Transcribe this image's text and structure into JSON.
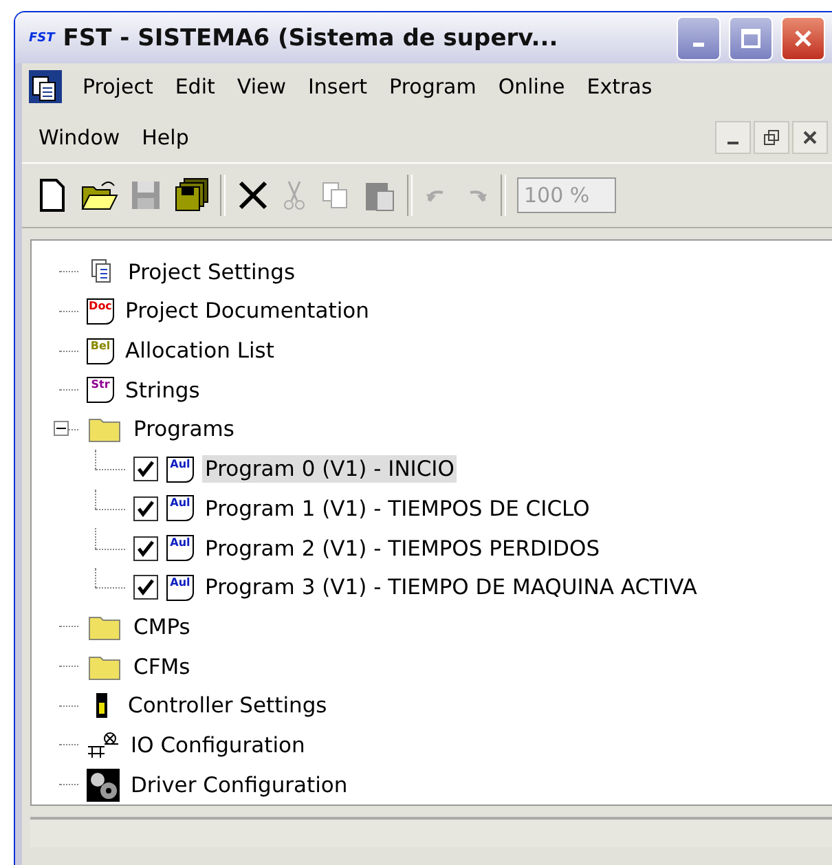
{
  "window": {
    "logo": "FST",
    "title": "FST - SISTEMA6 (Sistema de superv..."
  },
  "menu": [
    {
      "label": "Project"
    },
    {
      "label": "Edit"
    },
    {
      "label": "View"
    },
    {
      "label": "Insert"
    },
    {
      "label": "Program"
    },
    {
      "label": "Online"
    },
    {
      "label": "Extras"
    },
    {
      "label": "Window"
    },
    {
      "label": "Help"
    }
  ],
  "toolbar": {
    "zoom": "100 %"
  },
  "tree": [
    {
      "kind": "settings",
      "label": "Project Settings"
    },
    {
      "kind": "doc",
      "badge": "Doc",
      "label": "Project Documentation"
    },
    {
      "kind": "alloc",
      "badge": "Bel",
      "label": "Allocation List"
    },
    {
      "kind": "strings",
      "badge": "Str",
      "label": "Strings"
    },
    {
      "kind": "folder",
      "label": "Programs",
      "expanded": true,
      "children": [
        {
          "kind": "program",
          "badge": "Aul",
          "label": "Program  0 (V1) - INICIO",
          "checked": true,
          "selected": true
        },
        {
          "kind": "program",
          "badge": "Aul",
          "label": "Program  1 (V1) - TIEMPOS DE CICLO",
          "checked": true,
          "selected": false
        },
        {
          "kind": "program",
          "badge": "Aul",
          "label": "Program  2 (V1) - TIEMPOS PERDIDOS",
          "checked": true,
          "selected": false
        },
        {
          "kind": "program",
          "badge": "Aul",
          "label": "Program  3 (V1) - TIEMPO DE MAQUINA ACTIVA",
          "checked": true,
          "selected": false
        }
      ]
    },
    {
      "kind": "folder",
      "label": "CMPs"
    },
    {
      "kind": "folder",
      "label": "CFMs"
    },
    {
      "kind": "controller",
      "label": "Controller Settings"
    },
    {
      "kind": "io",
      "label": "IO Configuration"
    },
    {
      "kind": "driver",
      "label": "Driver Configuration"
    }
  ]
}
